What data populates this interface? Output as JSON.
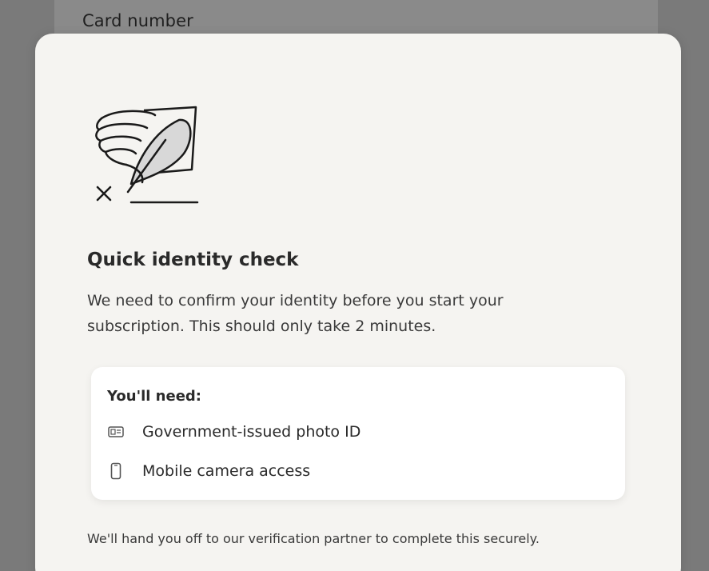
{
  "background": {
    "field_label": "Card number"
  },
  "modal": {
    "illustration": "signature-pen-icon",
    "title": "Quick identity check",
    "description": "We need to confirm your identity before you start your subscription. This should only take 2 minutes.",
    "needs": {
      "heading": "You'll need:",
      "items": [
        {
          "icon": "id-card-icon",
          "label": "Government-issued photo ID"
        },
        {
          "icon": "phone-icon",
          "label": "Mobile camera access"
        }
      ]
    },
    "footer": "We'll hand you off to our verification partner to complete this securely."
  },
  "colors": {
    "overlay": "#7a7a7a",
    "modal_bg": "#f5f4f1",
    "card_bg": "#ffffff",
    "text": "#2a2a2a"
  }
}
